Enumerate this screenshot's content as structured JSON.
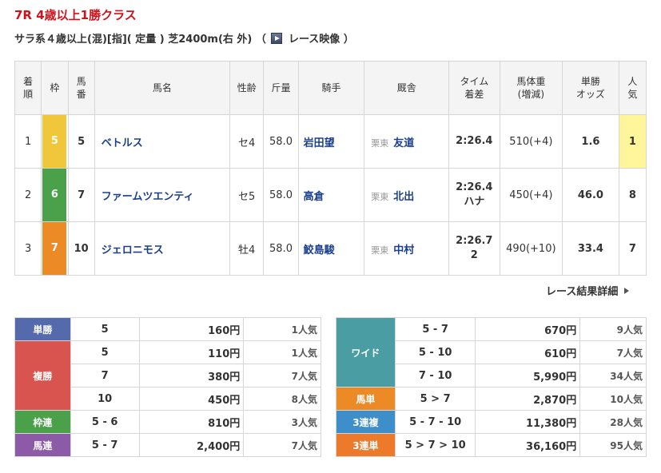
{
  "race": {
    "title": "7R 4歳以上1勝クラス",
    "conditions": "サラ系４歳以上(混)[指]( 定量 ) 芝2400m(右 外) （",
    "video_label": "レース映像",
    "conditions_end": "）"
  },
  "table": {
    "headers": [
      "着\n順",
      "枠",
      "馬\n番",
      "馬名",
      "性齢",
      "斤量",
      "騎手",
      "厩舎",
      "タイム\n着差",
      "馬体重\n(増減)",
      "単勝\nオッズ",
      "人\n気"
    ],
    "rows": [
      {
        "rank": "1",
        "waku": "5",
        "num": "5",
        "horse": "ベトルス",
        "sexage": "セ4",
        "weight": "58.0",
        "jockey": "岩田望",
        "area": "栗東",
        "trainer": "友道",
        "time": "2:26.4",
        "margin": "",
        "body": "510(+4)",
        "odds": "1.6",
        "pop": "1"
      },
      {
        "rank": "2",
        "waku": "6",
        "num": "7",
        "horse": "ファームツエンティ",
        "sexage": "セ5",
        "weight": "58.0",
        "jockey": "高倉",
        "area": "栗東",
        "trainer": "北出",
        "time": "2:26.4",
        "margin": "ハナ",
        "body": "450(+4)",
        "odds": "46.0",
        "pop": "8"
      },
      {
        "rank": "3",
        "waku": "7",
        "num": "10",
        "horse": "ジェロニモス",
        "sexage": "牡4",
        "weight": "58.0",
        "jockey": "鮫島駿",
        "area": "栗東",
        "trainer": "中村",
        "time": "2:26.7",
        "margin": "2",
        "body": "490(+10)",
        "odds": "33.4",
        "pop": "7"
      }
    ]
  },
  "detail_link": "レース結果詳細",
  "payouts_left": {
    "tansho": {
      "label": "単勝",
      "rows": [
        {
          "combo": "5",
          "yen": "160円",
          "pop": "1人気"
        }
      ]
    },
    "fukusho": {
      "label": "複勝",
      "rows": [
        {
          "combo": "5",
          "yen": "110円",
          "pop": "1人気"
        },
        {
          "combo": "7",
          "yen": "380円",
          "pop": "7人気"
        },
        {
          "combo": "10",
          "yen": "450円",
          "pop": "8人気"
        }
      ]
    },
    "wakuren": {
      "label": "枠連",
      "rows": [
        {
          "combo": "5 - 6",
          "yen": "810円",
          "pop": "3人気"
        }
      ]
    },
    "umaren": {
      "label": "馬連",
      "rows": [
        {
          "combo": "5 - 7",
          "yen": "2,400円",
          "pop": "7人気"
        }
      ]
    }
  },
  "payouts_right": {
    "wide": {
      "label": "ワイド",
      "rows": [
        {
          "combo": "5 - 7",
          "yen": "670円",
          "pop": "9人気"
        },
        {
          "combo": "5 - 10",
          "yen": "610円",
          "pop": "7人気"
        },
        {
          "combo": "7 - 10",
          "yen": "5,990円",
          "pop": "34人気"
        }
      ]
    },
    "umatan": {
      "label": "馬単",
      "rows": [
        {
          "combo": "5 > 7",
          "yen": "2,870円",
          "pop": "10人気"
        }
      ]
    },
    "sanrenpuku": {
      "label": "3連複",
      "rows": [
        {
          "combo": "5 - 7 - 10",
          "yen": "11,380円",
          "pop": "28人気"
        }
      ]
    },
    "sanrentan": {
      "label": "3連単",
      "rows": [
        {
          "combo": "5 > 7 > 10",
          "yen": "36,160円",
          "pop": "95人気"
        }
      ]
    }
  },
  "colors": {
    "title_red": "#d0121b",
    "link_blue": "#1b3f8c",
    "waku5": "#f0c63a",
    "waku6": "#4aa14a",
    "waku7": "#ec8a26",
    "pop1_bg": "#fff59a"
  }
}
